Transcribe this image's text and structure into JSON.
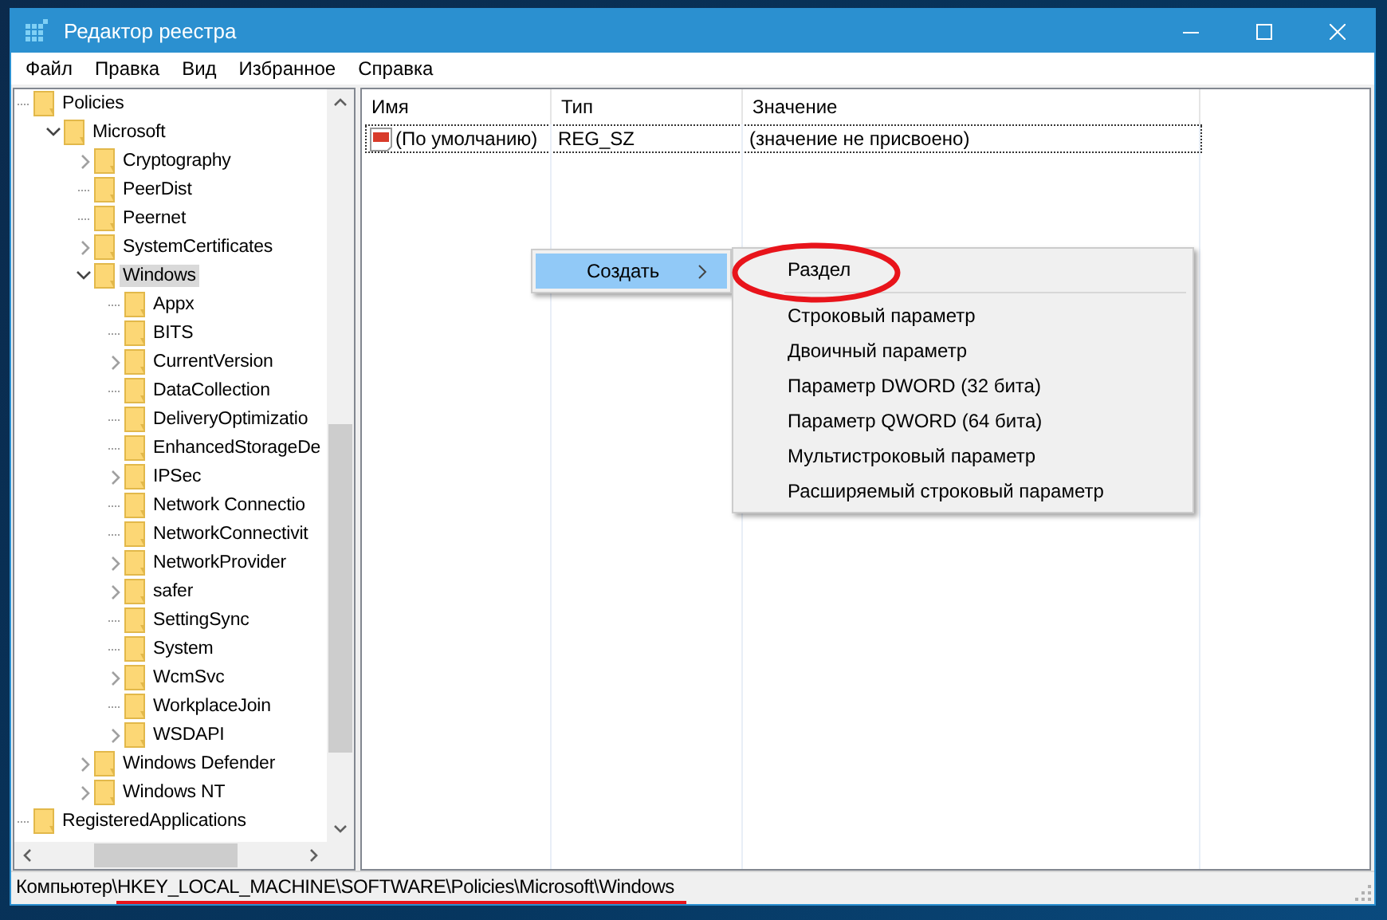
{
  "window": {
    "title": "Редактор реестра"
  },
  "menu_bar": [
    "Файл",
    "Правка",
    "Вид",
    "Избранное",
    "Справка"
  ],
  "tree": [
    {
      "label": "Policies",
      "kind": "leaf",
      "selected": false,
      "children": [
        {
          "label": "Microsoft",
          "kind": "node",
          "expanded": true,
          "selected": false,
          "children": [
            {
              "label": "Cryptography",
              "kind": "node",
              "expanded": false,
              "selected": false
            },
            {
              "label": "PeerDist",
              "kind": "leaf",
              "selected": false
            },
            {
              "label": "Peernet",
              "kind": "leaf",
              "selected": false
            },
            {
              "label": "SystemCertificates",
              "kind": "node",
              "expanded": false,
              "selected": false
            },
            {
              "label": "Windows",
              "kind": "node",
              "expanded": true,
              "selected": true,
              "children": [
                {
                  "label": "Appx",
                  "kind": "leaf",
                  "selected": false
                },
                {
                  "label": "BITS",
                  "kind": "leaf",
                  "selected": false
                },
                {
                  "label": "CurrentVersion",
                  "kind": "node",
                  "expanded": false,
                  "selected": false
                },
                {
                  "label": "DataCollection",
                  "kind": "leaf",
                  "selected": false
                },
                {
                  "label": "DeliveryOptimizatio",
                  "kind": "leaf",
                  "selected": false
                },
                {
                  "label": "EnhancedStorageDe",
                  "kind": "leaf",
                  "selected": false
                },
                {
                  "label": "IPSec",
                  "kind": "node",
                  "expanded": false,
                  "selected": false
                },
                {
                  "label": "Network Connectio",
                  "kind": "leaf",
                  "selected": false
                },
                {
                  "label": "NetworkConnectivit",
                  "kind": "leaf",
                  "selected": false
                },
                {
                  "label": "NetworkProvider",
                  "kind": "node",
                  "expanded": false,
                  "selected": false
                },
                {
                  "label": "safer",
                  "kind": "node",
                  "expanded": false,
                  "selected": false
                },
                {
                  "label": "SettingSync",
                  "kind": "leaf",
                  "selected": false
                },
                {
                  "label": "System",
                  "kind": "leaf",
                  "selected": false
                },
                {
                  "label": "WcmSvc",
                  "kind": "node",
                  "expanded": false,
                  "selected": false
                },
                {
                  "label": "WorkplaceJoin",
                  "kind": "leaf",
                  "selected": false
                },
                {
                  "label": "WSDAPI",
                  "kind": "node",
                  "expanded": false,
                  "selected": false
                }
              ]
            },
            {
              "label": "Windows Defender",
              "kind": "node",
              "expanded": false,
              "selected": false
            },
            {
              "label": "Windows NT",
              "kind": "node",
              "expanded": false,
              "selected": false
            }
          ]
        }
      ]
    },
    {
      "label": "RegisteredApplications",
      "kind": "leaf",
      "selected": false
    }
  ],
  "table": {
    "columns": [
      "Имя",
      "Тип",
      "Значение"
    ],
    "rows": [
      {
        "name": "(По умолчанию)",
        "type": "REG_SZ",
        "value": "(значение не присвоено)",
        "focused": true
      }
    ]
  },
  "context_menu": {
    "items": [
      {
        "label": "Создать",
        "submenu": true,
        "selected": true
      }
    ]
  },
  "submenu": {
    "items": [
      {
        "label": "Раздел",
        "circled": true
      },
      {
        "kind": "separator"
      },
      {
        "label": "Строковый параметр",
        "circled": false
      },
      {
        "label": "Двоичный параметр",
        "circled": false
      },
      {
        "label": "Параметр DWORD (32 бита)",
        "circled": false
      },
      {
        "label": "Параметр QWORD (64 бита)",
        "circled": false
      },
      {
        "label": "Мультистроковый параметр",
        "circled": false
      },
      {
        "label": "Расширяемый строковый параметр",
        "circled": false
      }
    ]
  },
  "status_bar": {
    "path_prefix": "Компьютер\\",
    "path": "HKEY_LOCAL_MACHINE\\SOFTWARE\\Policies\\Microsoft\\Windows",
    "path_underlined": true
  }
}
